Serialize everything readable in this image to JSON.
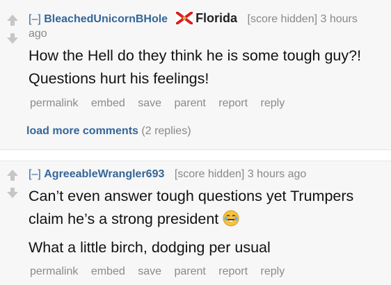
{
  "comment1": {
    "toggle": "[–]",
    "author": "BleachedUnicornBHole",
    "flair": "Florida",
    "score": "[score hidden]",
    "time_line1": "3 hours",
    "time_line2": "ago",
    "body_line1": "How the Hell do they think he is some tough guy?!",
    "body_line2": "Questions hurt his feelings!",
    "buttons": [
      "permalink",
      "embed",
      "save",
      "parent",
      "report",
      "reply"
    ]
  },
  "load_more": {
    "label": "load more comments",
    "count": "(2 replies)"
  },
  "comment2": {
    "toggle": "[–]",
    "author": "AgreeableWrangler693",
    "score": "[score hidden]",
    "time": "3 hours ago",
    "para1_line1": "Can’t even answer tough questions yet Trumpers",
    "para1_line2": "claim he’s a strong president",
    "para2": "What a little birch, dodging per usual",
    "buttons": [
      "permalink",
      "embed",
      "save",
      "parent",
      "report",
      "reply"
    ]
  },
  "icons": {
    "upvote": "up-arrow-icon",
    "downvote": "down-arrow-icon",
    "flag": "florida-flag-icon",
    "emoji": "tears-of-joy-emoji-icon"
  },
  "colors": {
    "link": "#336699",
    "muted": "#888888",
    "arrow": "#c6c6c6",
    "background": "#f7f7f8"
  }
}
